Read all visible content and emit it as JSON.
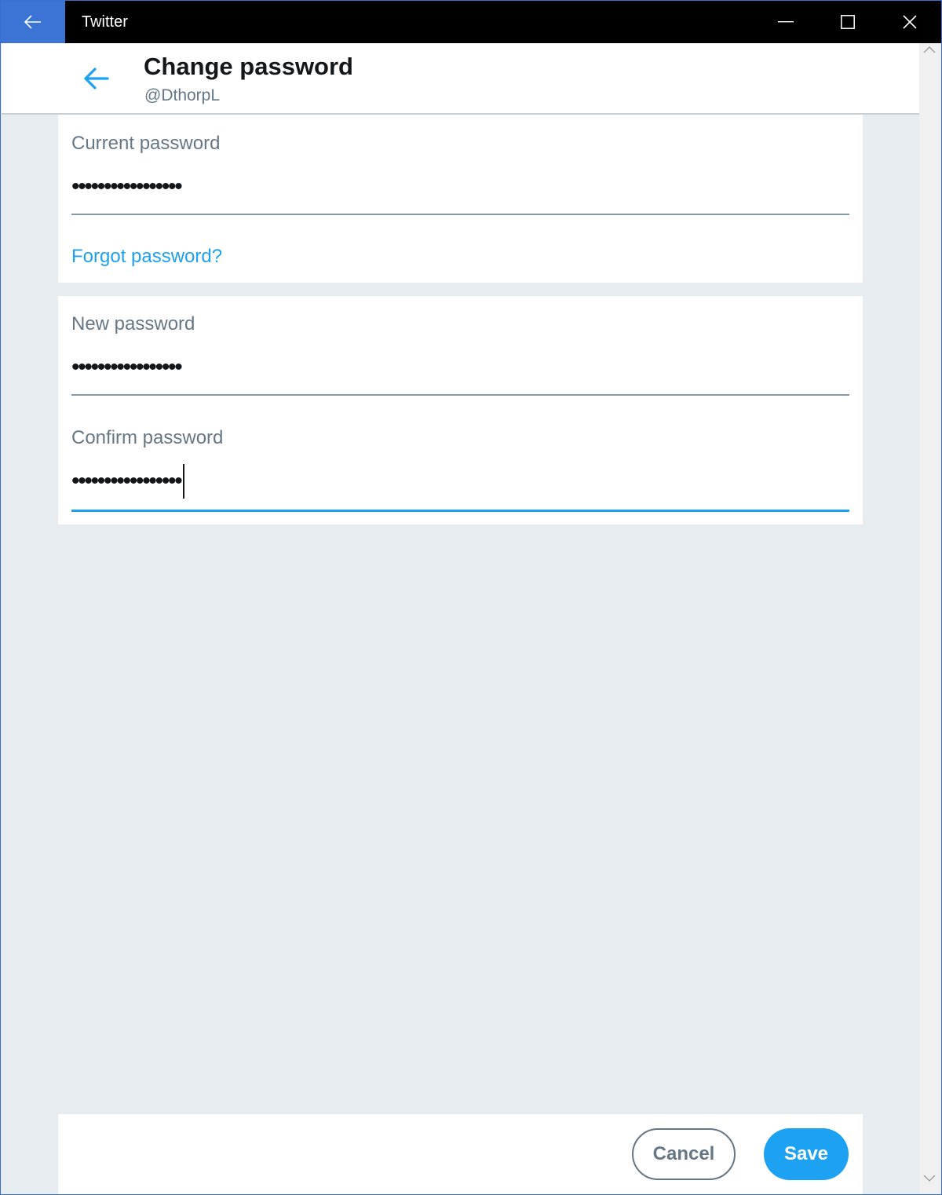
{
  "window": {
    "title": "Twitter",
    "back_icon": "arrow-left-icon",
    "minimize_icon": "minimize-icon",
    "maximize_icon": "maximize-icon",
    "close_icon": "close-icon"
  },
  "header": {
    "title": "Change password",
    "handle": "@DthorpL",
    "back_icon": "arrow-left-icon"
  },
  "form": {
    "current_password": {
      "label": "Current password",
      "value": "•••••••••••••••••"
    },
    "forgot_link": "Forgot password?",
    "new_password": {
      "label": "New password",
      "value": "•••••••••••••••••"
    },
    "confirm_password": {
      "label": "Confirm password",
      "value": "•••••••••••••••••"
    }
  },
  "actions": {
    "cancel_label": "Cancel",
    "save_label": "Save"
  },
  "colors": {
    "accent": "#1da1f2",
    "background": "#e6ecf0",
    "titlebar": "#000000",
    "titlebar_back": "#3b74d4",
    "secondary_text": "#657786"
  }
}
